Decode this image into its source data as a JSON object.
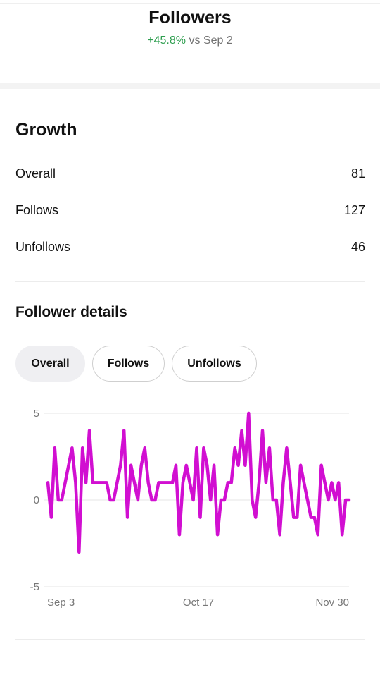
{
  "header": {
    "title": "Followers",
    "delta": "+45.8%",
    "compare_text": "vs Sep 2"
  },
  "growth": {
    "title": "Growth",
    "rows": [
      {
        "label": "Overall",
        "value": "81"
      },
      {
        "label": "Follows",
        "value": "127"
      },
      {
        "label": "Unfollows",
        "value": "46"
      }
    ]
  },
  "details": {
    "title": "Follower details",
    "chips": [
      {
        "label": "Overall",
        "active": true
      },
      {
        "label": "Follows",
        "active": false
      },
      {
        "label": "Unfollows",
        "active": false
      }
    ]
  },
  "colors": {
    "accent_line": "#d10fd1",
    "positive": "#2e9e4f",
    "muted_text": "#737373"
  },
  "chart_data": {
    "type": "line",
    "title": "",
    "xlabel": "",
    "ylabel": "",
    "ylim": [
      -5,
      5
    ],
    "yticks": [
      5,
      0,
      -5
    ],
    "x_ticks": [
      "Sep 3",
      "Oct 17",
      "Nov 30"
    ],
    "grid": true,
    "series": [
      {
        "color": "#d10fd1",
        "values": [
          1,
          -1,
          3,
          0,
          0,
          1,
          2,
          3,
          1,
          -3,
          3,
          1,
          4,
          1,
          1,
          1,
          1,
          1,
          0,
          0,
          1,
          2,
          4,
          -1,
          2,
          1,
          0,
          2,
          3,
          1,
          0,
          0,
          1,
          1,
          1,
          1,
          1,
          2,
          -2,
          1,
          2,
          1,
          0,
          3,
          -1,
          3,
          2,
          0,
          2,
          -2,
          0,
          0,
          1,
          1,
          3,
          2,
          4,
          2,
          5,
          0,
          -1,
          1,
          4,
          1,
          3,
          0,
          0,
          -2,
          1,
          3,
          1,
          -1,
          -1,
          2,
          1,
          0,
          -1,
          -1,
          -2,
          2,
          1,
          0,
          1,
          0,
          1,
          -2,
          0,
          0
        ]
      }
    ]
  }
}
